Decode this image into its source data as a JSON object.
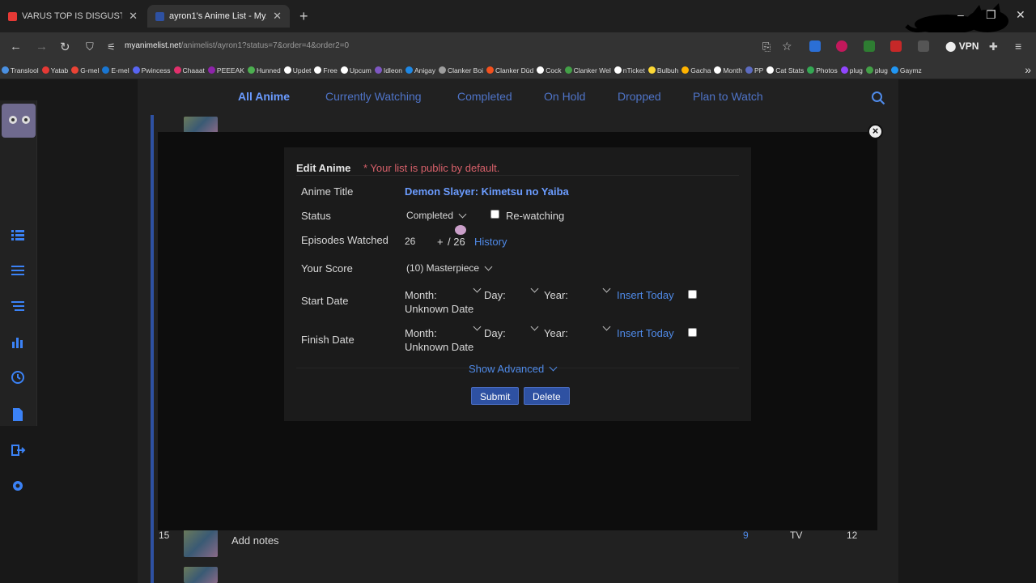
{
  "browser": {
    "tabs": [
      {
        "title": "VARUS TOP IS DISGUSTING WITH",
        "color": "#e53935"
      },
      {
        "title": "ayron1's Anime List - MyAnimeList",
        "color": "#2e51a2"
      }
    ],
    "url_domain": "myanimelist.net",
    "url_path": "/animelist/ayron1?status=7&order=4&order2=0",
    "vpn_label": "VPN",
    "bookmarks": [
      {
        "label": "Translool",
        "color": "#4a90e2"
      },
      {
        "label": "Yatab",
        "color": "#e53935"
      },
      {
        "label": "G-mel",
        "color": "#ea4335"
      },
      {
        "label": "E-mel",
        "color": "#1976d2"
      },
      {
        "label": "Pwincess",
        "color": "#5865f2"
      },
      {
        "label": "Chaaat",
        "color": "#e1306c"
      },
      {
        "label": "PEEEAK",
        "color": "#8e24aa"
      },
      {
        "label": "Hunned",
        "color": "#4caf50"
      },
      {
        "label": "Updet",
        "color": "#ffffff"
      },
      {
        "label": "Free",
        "color": "#ffffff"
      },
      {
        "label": "Upcum",
        "color": "#ffffff"
      },
      {
        "label": "Idleon",
        "color": "#7e57c2"
      },
      {
        "label": "Anigay",
        "color": "#1e88e5"
      },
      {
        "label": "Clanker Boi",
        "color": "#9e9e9e"
      },
      {
        "label": "Clanker Düd",
        "color": "#f4511e"
      },
      {
        "label": "Cock",
        "color": "#ffffff"
      },
      {
        "label": "Clanker Wel",
        "color": "#43a047"
      },
      {
        "label": "nTicket",
        "color": "#ffffff"
      },
      {
        "label": "Bulbuh",
        "color": "#fdd835"
      },
      {
        "label": "Gacha",
        "color": "#ffb300"
      },
      {
        "label": "Month",
        "color": "#ffffff"
      },
      {
        "label": "PP",
        "color": "#5c6bc0"
      },
      {
        "label": "Cat Stats",
        "color": "#ffffff"
      },
      {
        "label": "Photos",
        "color": "#34a853"
      },
      {
        "label": "plug",
        "color": "#9146ff"
      },
      {
        "label": "plug",
        "color": "#43a047"
      },
      {
        "label": "Gaymz",
        "color": "#2196f3"
      }
    ]
  },
  "status_nav": {
    "items": [
      "All Anime",
      "Currently Watching",
      "Completed",
      "On Hold",
      "Dropped",
      "Plan to Watch"
    ],
    "active": "All Anime"
  },
  "background_rows": [
    {
      "num": "15",
      "notes": "Add notes",
      "score": "9",
      "type": "TV",
      "progress": "12"
    }
  ],
  "dialog": {
    "title": "Edit Anime",
    "note": "* Your list is public by default.",
    "anime_title_label": "Anime Title",
    "anime_title": "Demon Slayer: Kimetsu no Yaiba",
    "status_label": "Status",
    "status_value": "Completed",
    "rewatching_label": "Re-watching",
    "episodes_label": "Episodes Watched",
    "episodes_value": "26",
    "episodes_plus": "+",
    "episodes_total": "/ 26",
    "history_label": "History",
    "score_label": "Your Score",
    "score_value": "(10) Masterpiece",
    "start_date_label": "Start Date",
    "finish_date_label": "Finish Date",
    "month_label": "Month:",
    "day_label": "Day:",
    "year_label": "Year:",
    "insert_today_label": "Insert Today",
    "unknown_date_label": "Unknown Date",
    "show_advanced_label": "Show Advanced",
    "submit_label": "Submit",
    "delete_label": "Delete"
  }
}
